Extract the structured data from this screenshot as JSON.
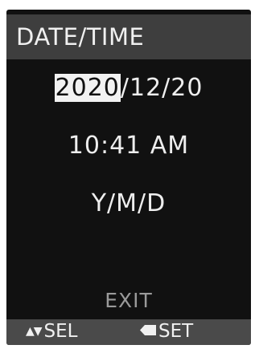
{
  "screen": {
    "title": "DATE/TIME",
    "date": {
      "year": "2020",
      "rest": "/12/20"
    },
    "time": "10:41 AM",
    "date_format": "Y/M/D",
    "exit_label": "EXIT"
  },
  "footer": {
    "select_icon": "up-down-arrows-icon",
    "select_label": "SEL",
    "set_icon": "back-arrow-icon",
    "set_label": "SET"
  },
  "colors": {
    "background": "#111111",
    "title_bar": "#3e3e3e",
    "footer_bar": "#4a4a4a",
    "highlight": "#f2f2f2",
    "text": "#eeeeee",
    "dim_text": "#9a9a9a"
  }
}
